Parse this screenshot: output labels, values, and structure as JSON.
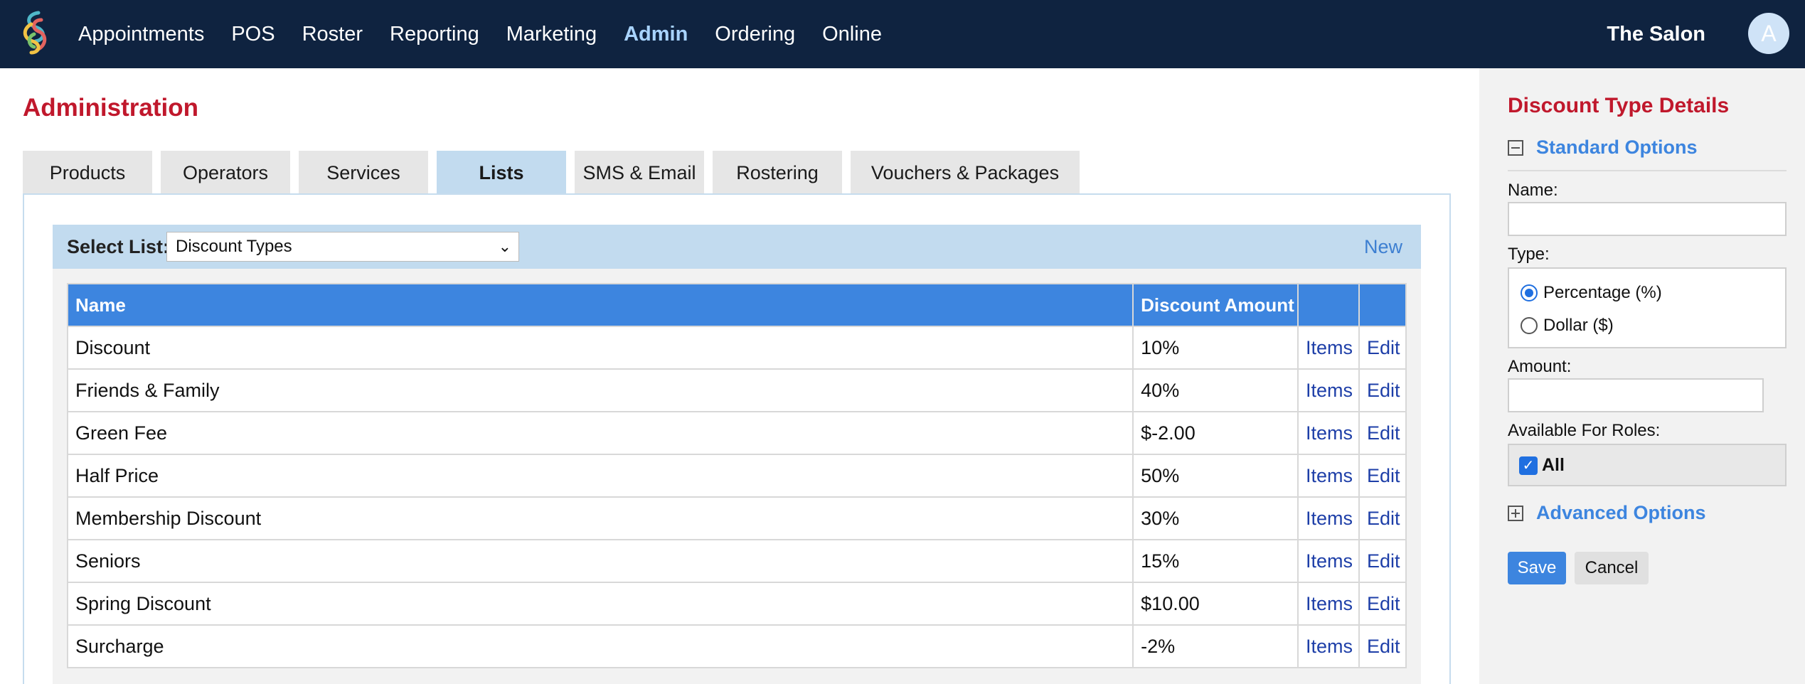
{
  "nav": {
    "items": [
      {
        "label": "Appointments"
      },
      {
        "label": "POS"
      },
      {
        "label": "Roster"
      },
      {
        "label": "Reporting"
      },
      {
        "label": "Marketing"
      },
      {
        "label": "Admin",
        "active": true
      },
      {
        "label": "Ordering"
      },
      {
        "label": "Online"
      }
    ],
    "salon_name": "The Salon",
    "avatar_initial": "A"
  },
  "page": {
    "title": "Administration",
    "tabs": [
      {
        "label": "Products"
      },
      {
        "label": "Operators"
      },
      {
        "label": "Services"
      },
      {
        "label": "Lists",
        "active": true
      },
      {
        "label": "SMS & Email"
      },
      {
        "label": "Rostering"
      },
      {
        "label": "Vouchers & Packages"
      }
    ]
  },
  "list_bar": {
    "label": "Select List:",
    "selected": "Discount Types",
    "new_link": "New"
  },
  "table": {
    "headers": [
      "Name",
      "Discount Amount",
      "",
      ""
    ],
    "rows": [
      {
        "name": "Discount",
        "amount": "10%",
        "items": "Items",
        "edit": "Edit"
      },
      {
        "name": "Friends & Family",
        "amount": "40%",
        "items": "Items",
        "edit": "Edit"
      },
      {
        "name": "Green Fee",
        "amount": "$-2.00",
        "items": "Items",
        "edit": "Edit"
      },
      {
        "name": "Half Price",
        "amount": "50%",
        "items": "Items",
        "edit": "Edit"
      },
      {
        "name": "Membership Discount",
        "amount": "30%",
        "items": "Items",
        "edit": "Edit"
      },
      {
        "name": "Seniors",
        "amount": "15%",
        "items": "Items",
        "edit": "Edit"
      },
      {
        "name": "Spring Discount",
        "amount": "$10.00",
        "items": "Items",
        "edit": "Edit"
      },
      {
        "name": "Surcharge",
        "amount": "-2%",
        "items": "Items",
        "edit": "Edit"
      }
    ]
  },
  "side": {
    "title": "Discount Type Details",
    "standard_options": "Standard Options",
    "name_label": "Name:",
    "name_value": "",
    "type_label": "Type:",
    "type_options": [
      {
        "label": "Percentage (%)",
        "selected": true
      },
      {
        "label": "Dollar ($)",
        "selected": false
      }
    ],
    "amount_label": "Amount:",
    "amount_value": "",
    "roles_label": "Available For Roles:",
    "roles_all": "All",
    "advanced_options": "Advanced Options",
    "save": "Save",
    "cancel": "Cancel"
  },
  "colors": {
    "nav_bg": "#0f2340",
    "title_red": "#c0182c",
    "accent_blue": "#3d85df",
    "link_blue": "#1e3fa8",
    "tab_active": "#c2dbef"
  }
}
